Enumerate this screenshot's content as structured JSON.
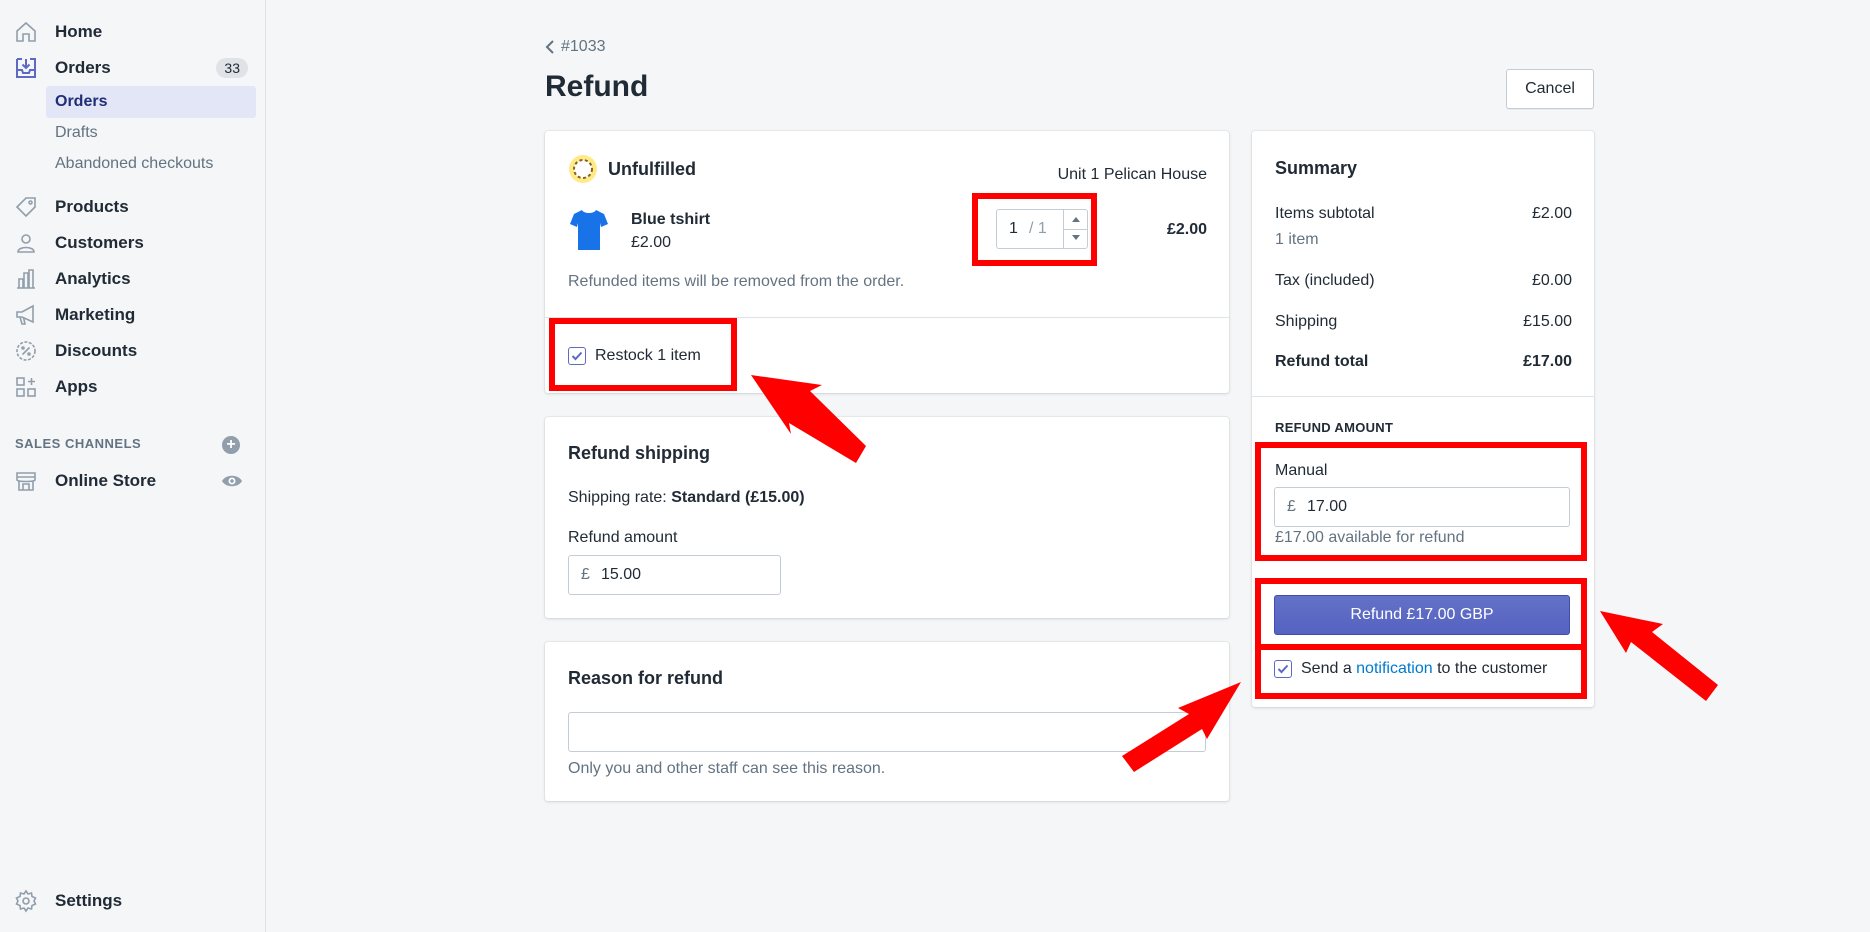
{
  "sidebar": {
    "home": "Home",
    "orders": "Orders",
    "orders_count": "33",
    "sub_orders": "Orders",
    "sub_drafts": "Drafts",
    "sub_abandoned": "Abandoned checkouts",
    "products": "Products",
    "customers": "Customers",
    "analytics": "Analytics",
    "marketing": "Marketing",
    "discounts": "Discounts",
    "apps": "Apps",
    "sales_channels_title": "SALES CHANNELS",
    "online_store": "Online Store",
    "settings": "Settings"
  },
  "header": {
    "back_label": "#1033",
    "title": "Refund",
    "cancel_label": "Cancel"
  },
  "unfulfilled": {
    "status": "Unfulfilled",
    "location": "Unit 1 Pelican House",
    "item_name": "Blue tshirt",
    "item_price": "£2.00",
    "qty_value": "1",
    "qty_max": "/ 1",
    "line_total": "£2.00",
    "note": "Refunded items will be removed from the order.",
    "restock_label": "Restock 1 item"
  },
  "shipping": {
    "title": "Refund shipping",
    "rate_prefix": "Shipping rate: ",
    "rate_name": "Standard",
    "rate_amount": "(£15.00)",
    "amount_label": "Refund amount",
    "currency": "£",
    "amount_value": "15.00"
  },
  "reason": {
    "title": "Reason for refund",
    "value": "",
    "help": "Only you and other staff can see this reason."
  },
  "summary": {
    "title": "Summary",
    "items_subtotal_label": "Items subtotal",
    "items_subtotal_value": "£2.00",
    "items_count": "1 item",
    "tax_label": "Tax (included)",
    "tax_value": "£0.00",
    "shipping_label": "Shipping",
    "shipping_value": "£15.00",
    "refund_total_label": "Refund total",
    "refund_total_value": "£17.00",
    "refund_amount_title": "REFUND AMOUNT",
    "manual_label": "Manual",
    "currency": "£",
    "manual_value": "17.00",
    "available": "£17.00 available for refund",
    "refund_button": "Refund £17.00 GBP",
    "notify_prefix": "Send a ",
    "notify_link": "notification",
    "notify_suffix": " to the customer"
  },
  "colors": {
    "accent": "#5c6ac4",
    "link": "#007ace",
    "annotation": "#ff0000"
  }
}
